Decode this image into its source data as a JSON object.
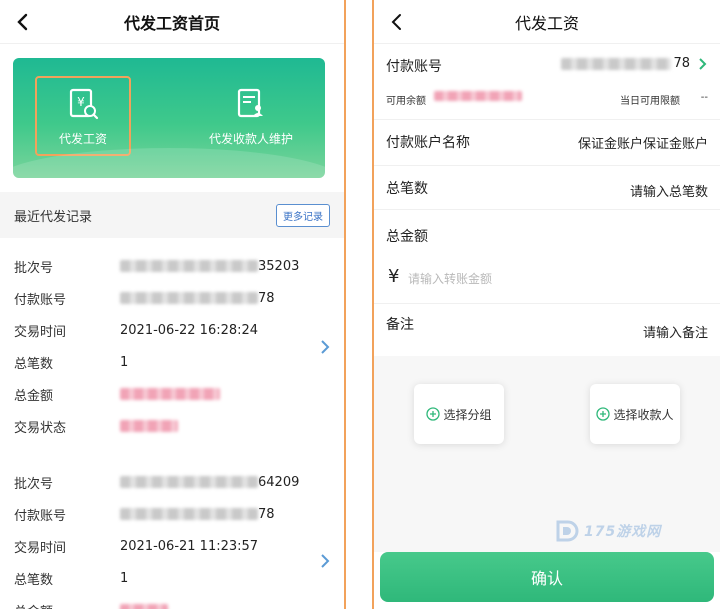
{
  "left": {
    "title": "代发工资首页",
    "tiles": [
      {
        "label": "代发工资",
        "icon": "payroll-icon"
      },
      {
        "label": "代发收款人维护",
        "icon": "payee-maintenance-icon"
      }
    ],
    "section_title": "最近代发记录",
    "more_label": "更多记录",
    "records": [
      {
        "fields": [
          {
            "key": "批次号",
            "tail": "35203"
          },
          {
            "key": "付款账号",
            "tail": "78"
          },
          {
            "key": "交易时间",
            "value": "2021-06-22 16:28:24"
          },
          {
            "key": "总笔数",
            "value": "1"
          },
          {
            "key": "总金额",
            "value": ""
          },
          {
            "key": "交易状态",
            "value": ""
          }
        ]
      },
      {
        "fields": [
          {
            "key": "批次号",
            "tail": "64209"
          },
          {
            "key": "付款账号",
            "tail": "78"
          },
          {
            "key": "交易时间",
            "value": "2021-06-21 11:23:57"
          },
          {
            "key": "总笔数",
            "value": "1"
          },
          {
            "key": "总金额",
            "value": ""
          }
        ]
      }
    ]
  },
  "right": {
    "title": "代发工资",
    "pay_account_label": "付款账号",
    "pay_account_tail": "78",
    "available_balance_label": "可用余额",
    "daily_limit_label": "当日可用限额",
    "daily_limit_value": "--",
    "account_name_label": "付款账户名称",
    "account_name_value": "保证金账户保证金账户",
    "total_count_label": "总笔数",
    "total_count_placeholder": "请输入总笔数",
    "total_amount_label": "总金额",
    "currency_symbol": "¥",
    "amount_placeholder": "请输入转账金额",
    "remark_label": "备注",
    "remark_placeholder": "请输入备注",
    "select_group_label": "选择分组",
    "select_payee_label": "选择收款人",
    "confirm_label": "确认",
    "watermark_text": "175游戏网"
  },
  "colors": {
    "accent_green": "#2fb87a",
    "highlight_orange": "#f2a25b",
    "link_blue": "#3a73c6"
  }
}
